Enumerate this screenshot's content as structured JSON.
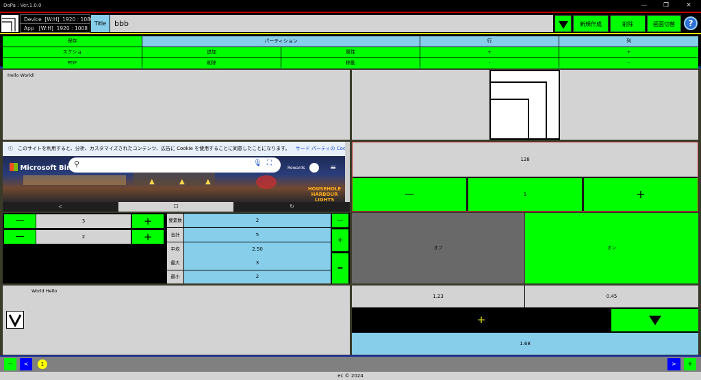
{
  "window": {
    "title": "DoPa : Ver.1.0.0",
    "minimize_glyph": "—",
    "maximize_glyph": "❐",
    "close_glyph": "✕"
  },
  "header": {
    "device_info": "Device  [W:H]  1920 : 1080",
    "app_info": "App   [W:H]  1920 : 1008",
    "title_label": "Title",
    "title_value": "bbb",
    "new_label": "新規作成",
    "delete_label": "削除",
    "switch_label": "画面切替",
    "help_glyph": "?"
  },
  "toolbar": {
    "save": "保存",
    "screenshot": "スクショ",
    "pdf": "PDF",
    "partition": "パーティション",
    "add": "追加",
    "attribute": "属性",
    "remove": "削除",
    "move": "移動",
    "row": "行",
    "col": "列",
    "row_plus": "+",
    "row_minus": "-",
    "col_plus": "+",
    "col_minus": "-"
  },
  "panels": {
    "hello_text": "Hello World!",
    "counter_value": "128",
    "counter_step": "1",
    "minus_glyph": "—",
    "plus_glyph": "+",
    "stepper1_value": "3",
    "stepper2_value": "2",
    "stats": [
      {
        "label": "要素数",
        "value": "2"
      },
      {
        "label": "合計",
        "value": "5"
      },
      {
        "label": "平均",
        "value": "2.50"
      },
      {
        "label": "最大",
        "value": "3"
      },
      {
        "label": "最小",
        "value": "2"
      }
    ],
    "ops": [
      "—",
      "+",
      "="
    ],
    "toggle_off": "オフ",
    "toggle_on": "オン",
    "world_hello": "World Hello",
    "num_a": "1.23",
    "num_b": "0.45",
    "num_result": "1.68",
    "add_glyph": "+"
  },
  "browser": {
    "cookie_text": "このサイトを利用すると、分析、カスタマイズされたコンテンツ、広告に Cookie を使用することに同意したことになります。",
    "cookie_link": "サード パーティの Cook",
    "brand": "Microsoft Bing",
    "rewards": "Rewards",
    "sign_text1": "HOUSEHOLE",
    "sign_text2": "HARBOUR LIGHTS",
    "nav_back": "<",
    "nav_home": "☐",
    "nav_refresh": "↻"
  },
  "bottom": {
    "minus": "−",
    "prev": "<",
    "page": "1",
    "next": ">",
    "plus": "+"
  },
  "footer": {
    "text": "ec © 2024"
  },
  "colors": {
    "green": "#00ff00",
    "skyblue": "#87ceeb",
    "gray": "#d3d3d3",
    "dark_gray": "#696969",
    "blue": "#0000ff",
    "red": "#c00000",
    "yellow": "#e6e600",
    "navy": "#1a2fa0"
  }
}
